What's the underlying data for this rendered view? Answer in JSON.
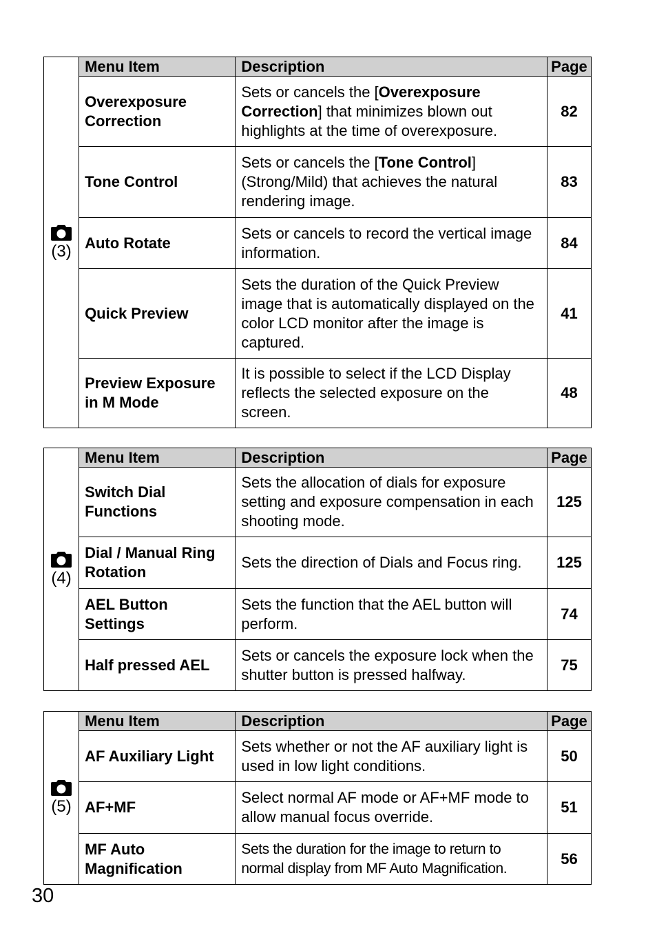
{
  "headers": {
    "item": "Menu Item",
    "description": "Description",
    "page": "Page"
  },
  "sections": [
    {
      "icon": "camera-icon",
      "label": "(3)",
      "rows": [
        {
          "item": "Overexposure Correction",
          "desc_pre": "Sets or cancels the [",
          "desc_bold": "Overexposure Correction",
          "desc_post": "] that minimizes blown out highlights at the time of overexposure.",
          "page": "82"
        },
        {
          "item": "Tone Control",
          "desc_pre": "Sets or cancels the [",
          "desc_bold": "Tone Control",
          "desc_post": "] (Strong/Mild) that achieves the natural rendering image.",
          "page": "83"
        },
        {
          "item": "Auto Rotate",
          "desc_pre": "Sets or cancels to record the vertical image information.",
          "page": "84"
        },
        {
          "item": "Quick Preview",
          "desc_pre": "Sets the duration of the Quick Preview image that is automatically displayed on the color LCD monitor after the image is captured.",
          "page": "41"
        },
        {
          "item": "Preview Exposure in M Mode",
          "desc_pre": "It is possible to select if the LCD Display reflects the selected exposure on the screen.",
          "page": "48"
        }
      ]
    },
    {
      "icon": "camera-icon",
      "label": "(4)",
      "rows": [
        {
          "item": "Switch Dial Functions",
          "desc_pre": "Sets the allocation of dials for exposure setting and exposure compensation in each shooting mode.",
          "page": "125"
        },
        {
          "item": "Dial / Manual Ring Rotation",
          "desc_pre": "Sets the direction of Dials and Focus ring.",
          "page": "125"
        },
        {
          "item": "AEL Button Settings",
          "desc_pre": "Sets the function that the AEL button will perform.",
          "page": "74"
        },
        {
          "item": "Half pressed AEL",
          "desc_pre": "Sets or cancels the exposure lock when the shutter button is pressed halfway.",
          "page": "75"
        }
      ]
    },
    {
      "icon": "camera-icon",
      "label": "(5)",
      "rows": [
        {
          "item": "AF Auxiliary Light",
          "desc_pre": "Sets whether or not the AF auxiliary light is used in low light conditions.",
          "page": "50"
        },
        {
          "item": "AF+MF",
          "desc_pre": "Select normal AF mode or AF+MF mode to allow manual focus override.",
          "page": "51"
        },
        {
          "item": "MF Auto Magnification",
          "desc_pre": "Sets the duration for the image to return to normal display from MF Auto Magnification.",
          "page": "56"
        }
      ]
    }
  ],
  "page_number": "30",
  "colors": {
    "header_bg": "#d0d0d0",
    "border": "#000000",
    "text": "#000000"
  }
}
